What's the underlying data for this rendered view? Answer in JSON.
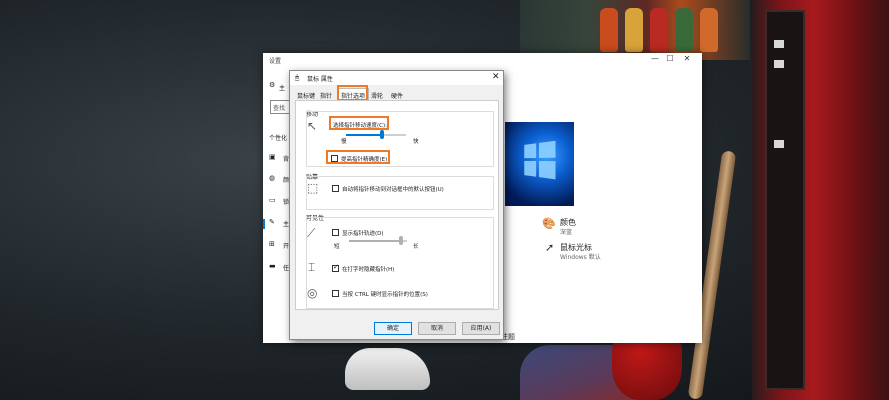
{
  "settings": {
    "title": "设置",
    "sidebar": {
      "home_label": "主",
      "search_placeholder": "查找",
      "section_label": "个性化",
      "items": [
        "背",
        "颜",
        "锁",
        "主",
        "开",
        "任"
      ]
    },
    "right": {
      "color_label": "颜色",
      "color_value": "深蓝",
      "cursor_label": "鼠标光标",
      "cursor_value": "Windows 默认",
      "under_text": "注题"
    }
  },
  "dialog": {
    "title": "鼠标 属性",
    "tabs": [
      "鼠标键",
      "指针",
      "指针选项",
      "滑轮",
      "硬件"
    ],
    "active_tab": "指针选项",
    "motion": {
      "title": "移动",
      "speed_label": "选择指针移动速度(C):",
      "slow": "慢",
      "fast": "快",
      "speed_value": 0.6,
      "precision_label": "提高指针精确度(E)",
      "precision_checked": false
    },
    "snap": {
      "title": "贴靠",
      "label": "自动将指针移动到对话框中的默认按钮(U)",
      "checked": false
    },
    "visibility": {
      "title": "可见性",
      "trails_label": "显示指针轨迹(D)",
      "trails_checked": false,
      "short": "短",
      "long": "长",
      "trails_value": 0.9,
      "hide_label": "在打字时隐藏指针(H)",
      "hide_checked": true,
      "ctrl_label": "当按 CTRL 键时显示指针的位置(S)",
      "ctrl_checked": false
    },
    "buttons": {
      "ok": "确定",
      "cancel": "取消",
      "apply": "应用(A)"
    }
  },
  "colors": {
    "highlight": "#f07a24",
    "accent": "#0078d7"
  }
}
